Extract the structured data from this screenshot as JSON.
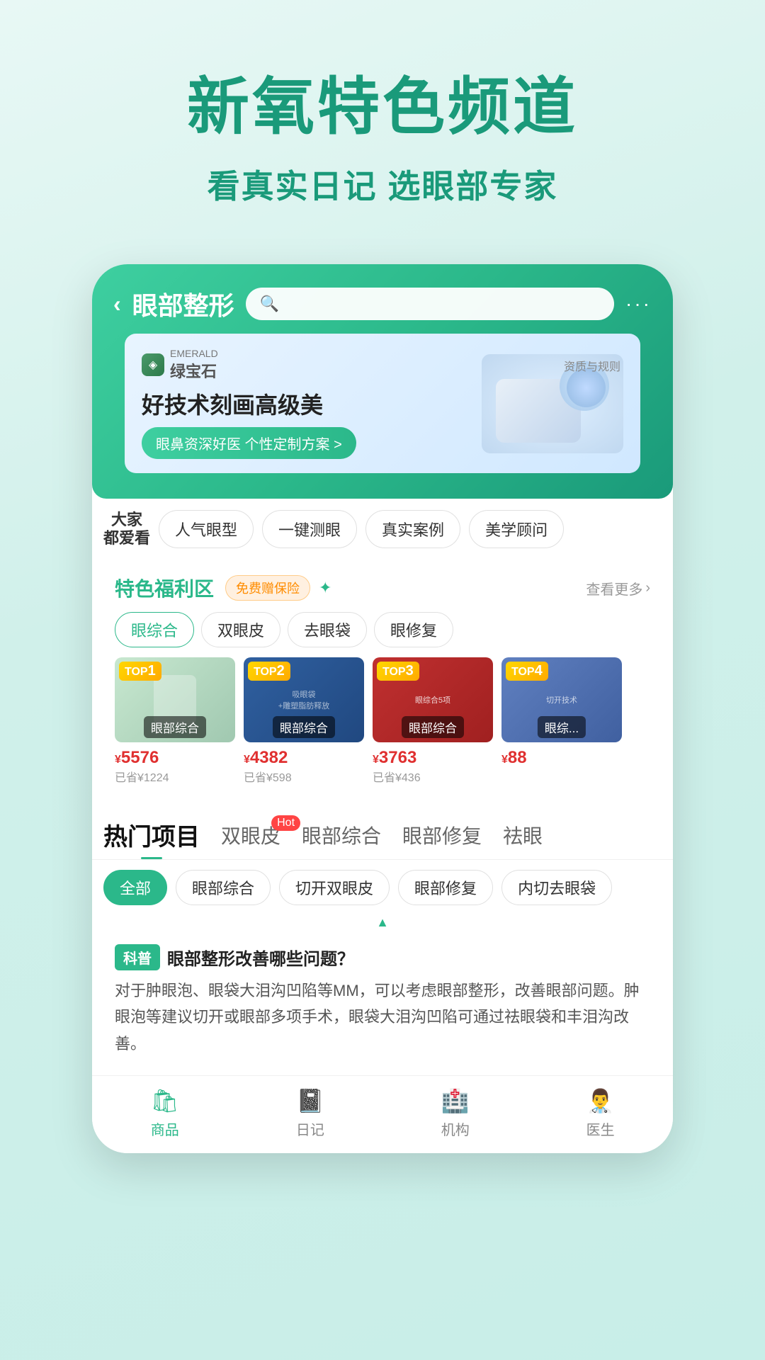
{
  "page": {
    "main_title": "新氧特色频道",
    "sub_title": "看真实日记 选眼部专家"
  },
  "header": {
    "back_label": "‹",
    "title": "眼部整形",
    "search_placeholder": "",
    "more_label": "···"
  },
  "banner": {
    "brand_name": "绿宝石",
    "brand_subtitle": "EMERALD",
    "main_text": "好技术刻画高级美",
    "cta_text": "眼鼻资深好医 个性定制方案 >",
    "tag": "资质与规则"
  },
  "quick_nav": {
    "label_line1": "大家",
    "label_line2": "都爱看",
    "tags": [
      "人气眼型",
      "一键测眼",
      "真实案例",
      "美学顾问"
    ]
  },
  "special_section": {
    "title": "特色福利区",
    "badge": "免费赠保险",
    "view_more": "查看更多",
    "sub_tabs": [
      "眼综合",
      "双眼皮",
      "去眼袋",
      "眼修复"
    ],
    "active_tab": "眼综合",
    "products": [
      {
        "top_num": "1",
        "bg": "1",
        "category": "眼部综合",
        "price": "¥5576",
        "saved": "已省¥1224"
      },
      {
        "top_num": "2",
        "bg": "2",
        "category": "眼部综合",
        "price": "¥4382",
        "saved": "已省¥598"
      },
      {
        "top_num": "3",
        "bg": "3",
        "category": "眼部综合",
        "price": "¥3763",
        "saved": "已省¥436"
      },
      {
        "top_num": "4",
        "bg": "4",
        "category": "眼综...",
        "price": "¥88",
        "saved": ""
      }
    ]
  },
  "main_tabs": [
    {
      "label": "热门项目",
      "active": true
    },
    {
      "label": "双眼皮",
      "hot": true,
      "active": false
    },
    {
      "label": "眼部综合",
      "active": false
    },
    {
      "label": "眼部修复",
      "active": false
    },
    {
      "label": "祛眼",
      "active": false
    }
  ],
  "filter_chips": [
    "全部",
    "眼部综合",
    "切开双眼皮",
    "眼部修复",
    "内切去眼袋"
  ],
  "active_chip": "全部",
  "article": {
    "type": "科普",
    "title": "眼部整形改善哪些问题？",
    "body": "对于肿眼泡、眼袋大泪沟凹陷等MM，可以考虑眼部整形，改善眼部问题。肿眼泡等建议切开或眼部多项手术，眼袋大泪沟凹陷可通过祛眼袋和丰泪沟改善。"
  },
  "bottom_nav": [
    {
      "label": "商品",
      "icon": "🛍",
      "active": true
    },
    {
      "label": "日记",
      "icon": "📓",
      "active": false
    },
    {
      "label": "机构",
      "icon": "🏥",
      "active": false
    },
    {
      "label": "医生",
      "icon": "👨‍⚕️",
      "active": false
    }
  ]
}
